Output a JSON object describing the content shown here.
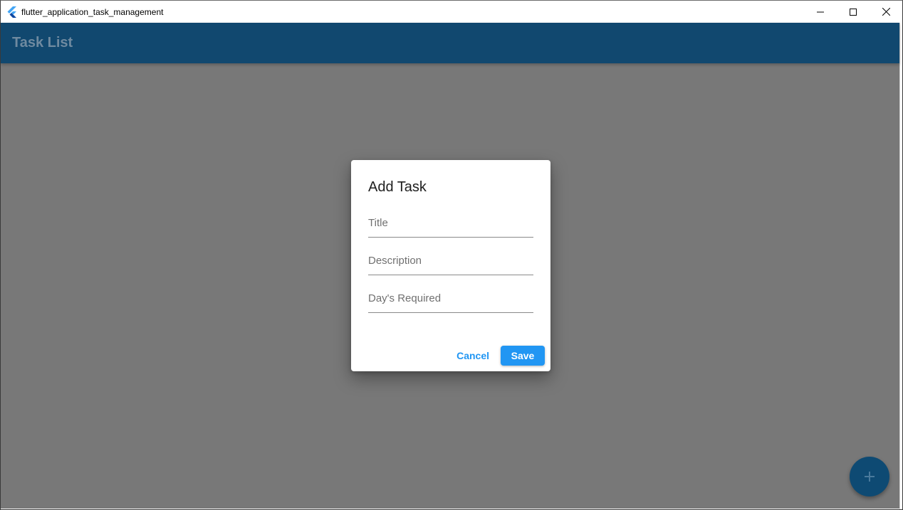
{
  "window": {
    "title": "flutter_application_task_management",
    "controls": [
      "minimize",
      "maximize",
      "close"
    ]
  },
  "appbar": {
    "title": "Task List"
  },
  "dialog": {
    "title": "Add Task",
    "fields": [
      {
        "placeholder": "Title",
        "value": ""
      },
      {
        "placeholder": "Description",
        "value": ""
      },
      {
        "placeholder": "Day's Required",
        "value": ""
      }
    ],
    "cancel_label": "Cancel",
    "save_label": "Save"
  },
  "fab": {
    "icon": "plus-icon"
  },
  "colors": {
    "appbar": "#11486f",
    "accent": "#2196f3",
    "fab": "#0e4a73",
    "scrim": "#787878"
  }
}
